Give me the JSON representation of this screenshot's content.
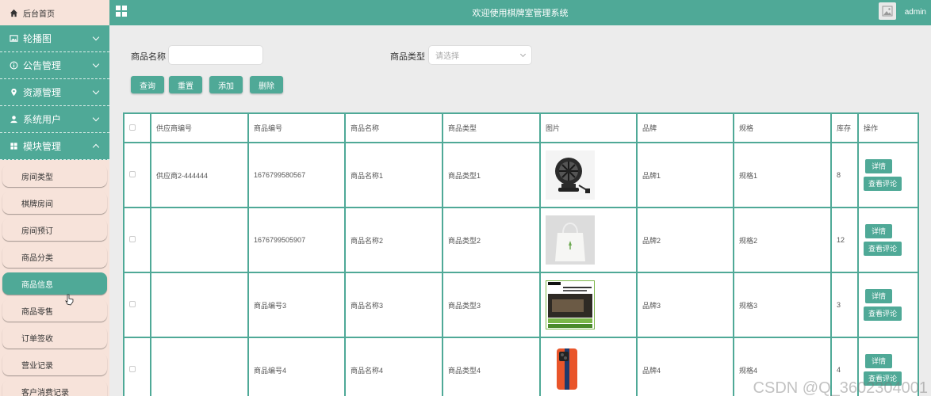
{
  "header": {
    "title": "欢迎使用棋牌室管理系统",
    "user": "admin"
  },
  "sidebar": {
    "home": "后台首页",
    "groups": [
      {
        "label": "轮播图",
        "icon": "image-icon"
      },
      {
        "label": "公告管理",
        "icon": "info-icon"
      },
      {
        "label": "资源管理",
        "icon": "location-pin-icon"
      },
      {
        "label": "系统用户",
        "icon": "user-icon"
      },
      {
        "label": "模块管理",
        "icon": "grid-icon"
      }
    ],
    "sub_items": [
      "房间类型",
      "棋牌房间",
      "房间预订",
      "商品分类",
      "商品信息",
      "商品零售",
      "订单签收",
      "营业记录",
      "客户消费记录"
    ],
    "active_item": "商品信息"
  },
  "search": {
    "name_label": "商品名称",
    "name_value": "",
    "type_label": "商品类型",
    "type_placeholder": "请选择"
  },
  "actions": {
    "query": "查询",
    "reset": "重置",
    "add": "添加",
    "delete": "删除"
  },
  "table": {
    "columns": [
      "供应商编号",
      "商品编号",
      "商品名称",
      "商品类型",
      "图片",
      "品牌",
      "规格",
      "库存",
      "操作"
    ],
    "rows": [
      {
        "supplier": "供应商2-444444",
        "code": "1676799580567",
        "name": "商品名称1",
        "type": "商品类型1",
        "image": "desk-fan",
        "brand": "品牌1",
        "spec": "规格1",
        "stock": "8"
      },
      {
        "supplier": "",
        "code": "1676799505907",
        "name": "商品名称2",
        "type": "商品类型2",
        "image": "tote-bag",
        "brand": "品牌2",
        "spec": "规格2",
        "stock": "12"
      },
      {
        "supplier": "",
        "code": "商品编号3",
        "name": "商品名称3",
        "type": "商品类型3",
        "image": "sony-tv-box",
        "brand": "品牌3",
        "spec": "规格3",
        "stock": "3"
      },
      {
        "supplier": "",
        "code": "商品编号4",
        "name": "商品名称4",
        "type": "商品类型4",
        "image": "phone",
        "brand": "品牌4",
        "spec": "规格4",
        "stock": "4"
      }
    ],
    "detail_label": "详情",
    "review_label": "查看评论"
  },
  "watermark": "CSDN @Q_3602304001",
  "colors": {
    "accent": "#4fa997",
    "sidebar_bg": "#f7e3da",
    "page_bg": "#ececec"
  }
}
